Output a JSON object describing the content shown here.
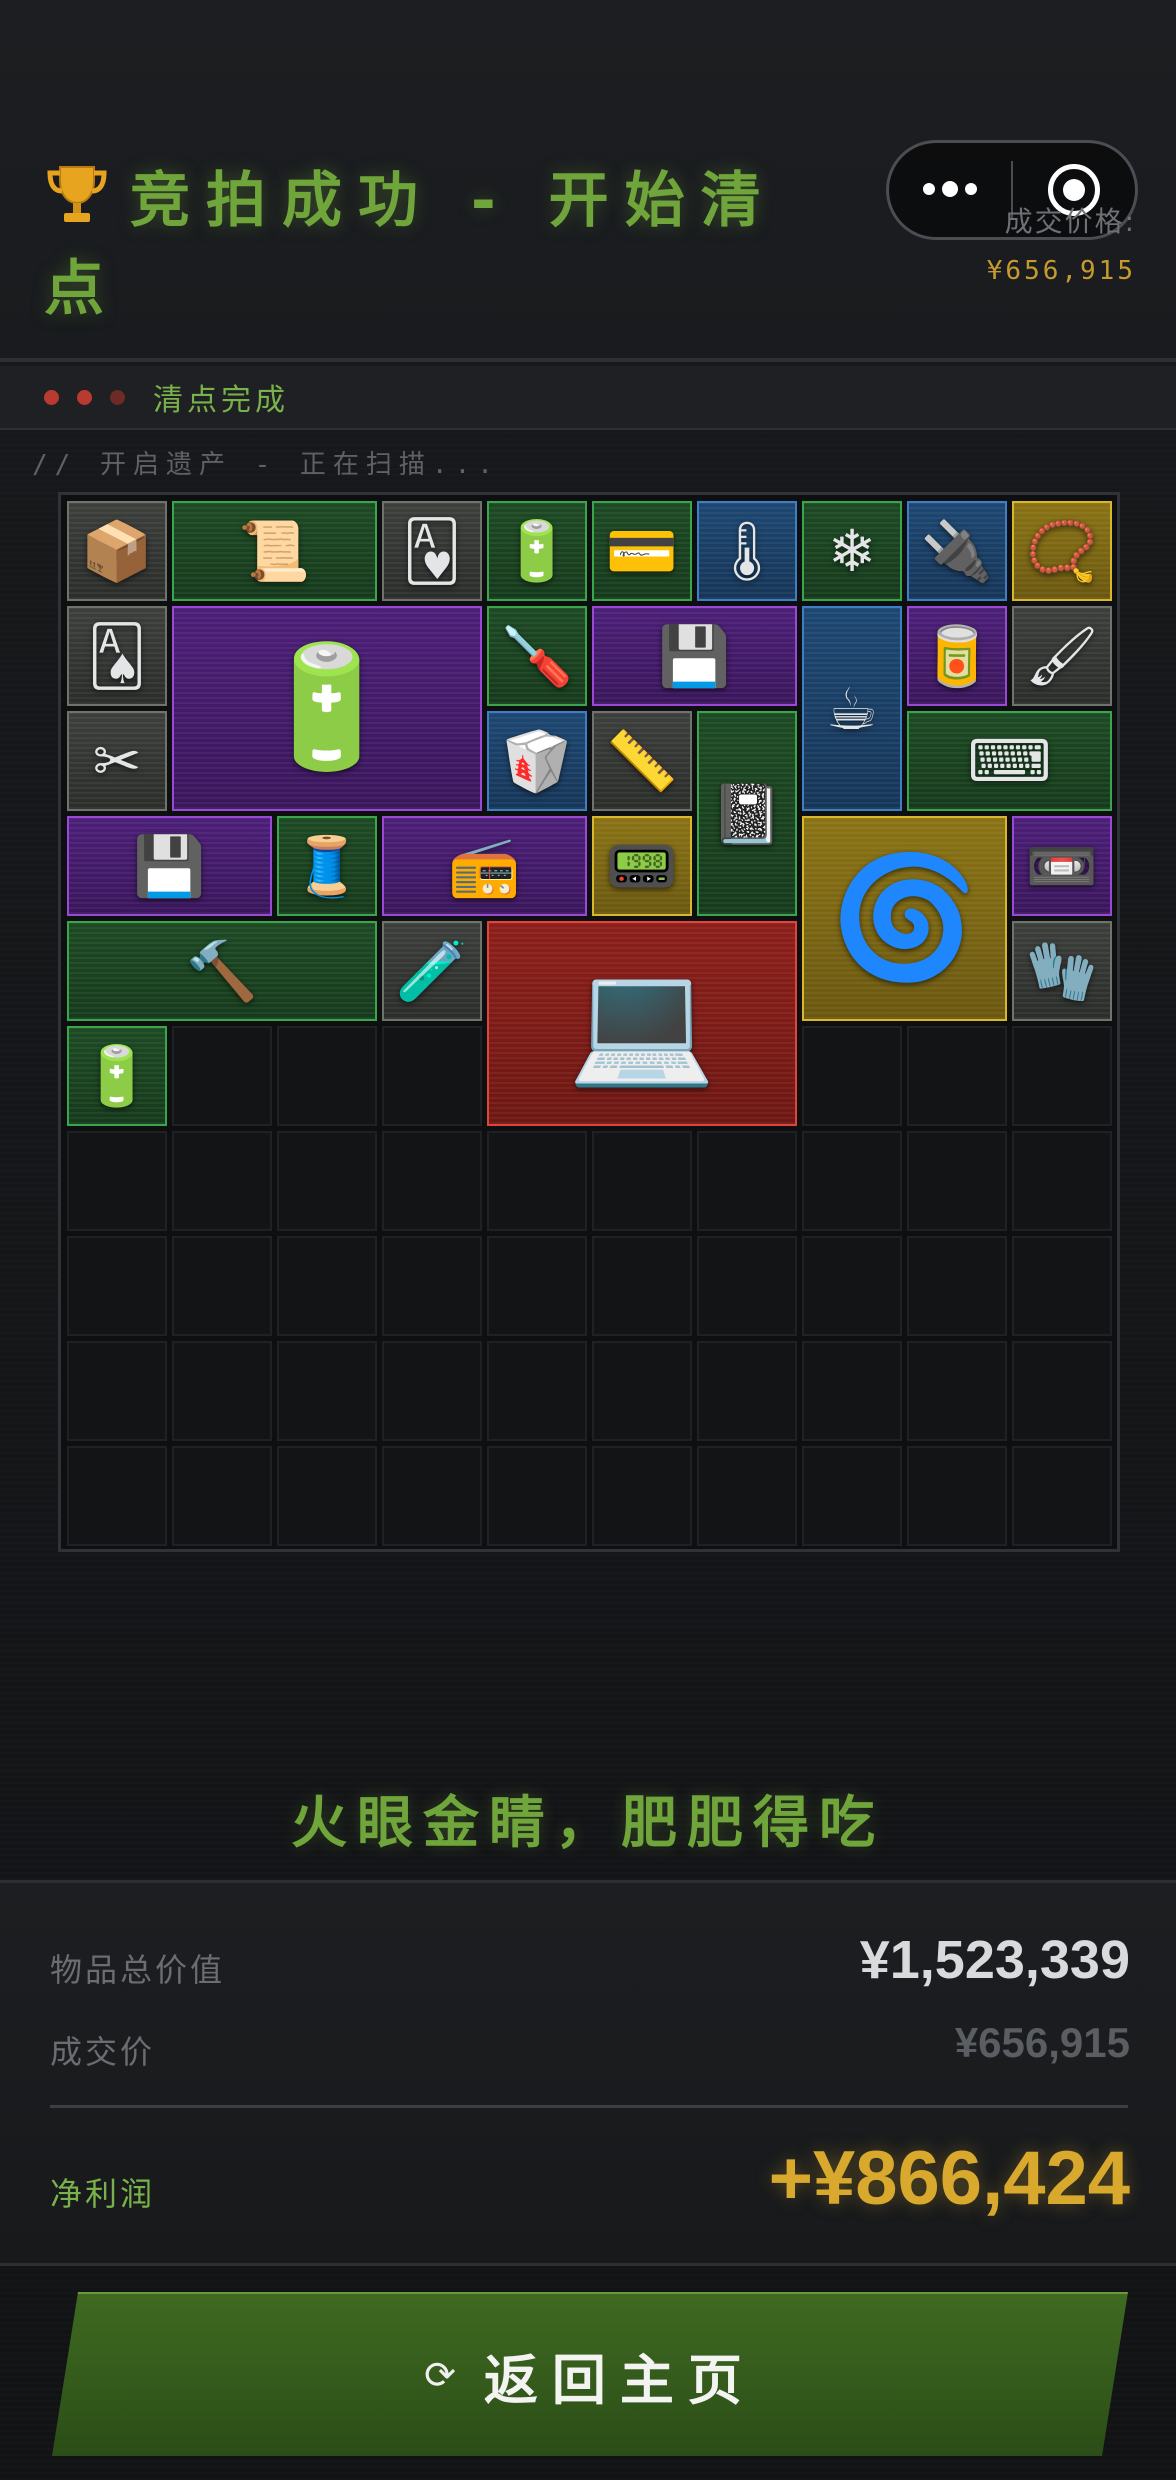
{
  "header": {
    "title": "竞拍成功 - 开始清点",
    "price_label": "成交价格:",
    "price_value": "¥656,915"
  },
  "status": {
    "dots": [
      "#b83a30",
      "#b83a30",
      "#6e2a26"
    ],
    "text": "清点完成"
  },
  "scan_text": "// 开启遗产 - 正在扫描...",
  "grid": {
    "cols": 10,
    "rows": 10,
    "items": [
      {
        "name": "cardboard-box-item",
        "icon": "📦",
        "rarity": "gray",
        "col": 0,
        "row": 0,
        "w": 1,
        "h": 1
      },
      {
        "name": "old-paper-item",
        "icon": "📜",
        "rarity": "green",
        "col": 1,
        "row": 0,
        "w": 2,
        "h": 1
      },
      {
        "name": "playing-card-portrait-item",
        "icon": "🂱",
        "rarity": "gray",
        "col": 3,
        "row": 0,
        "w": 1,
        "h": 1
      },
      {
        "name": "battery-pack-item",
        "icon": "🔋",
        "rarity": "green",
        "col": 4,
        "row": 0,
        "w": 1,
        "h": 1
      },
      {
        "name": "good-luck-card-item",
        "icon": "💳",
        "rarity": "green",
        "col": 5,
        "row": 0,
        "w": 1,
        "h": 1
      },
      {
        "name": "thermometer-gun-item",
        "icon": "🌡",
        "rarity": "blue",
        "col": 6,
        "row": 0,
        "w": 1,
        "h": 1
      },
      {
        "name": "cpu-cooler-item",
        "icon": "❄",
        "rarity": "green",
        "col": 7,
        "row": 0,
        "w": 1,
        "h": 1
      },
      {
        "name": "power-adapter-item",
        "icon": "🔌",
        "rarity": "blue",
        "col": 8,
        "row": 0,
        "w": 1,
        "h": 1
      },
      {
        "name": "gold-skull-necklace-item",
        "icon": "📿",
        "rarity": "gold",
        "col": 9,
        "row": 0,
        "w": 1,
        "h": 1
      },
      {
        "name": "playing-card-item",
        "icon": "🂡",
        "rarity": "gray",
        "col": 0,
        "row": 1,
        "w": 1,
        "h": 1
      },
      {
        "name": "car-battery-item",
        "icon": "🔋",
        "rarity": "purple",
        "col": 1,
        "row": 1,
        "w": 3,
        "h": 2
      },
      {
        "name": "screwdriver-tester-item",
        "icon": "🪛",
        "rarity": "green",
        "col": 4,
        "row": 1,
        "w": 1,
        "h": 1
      },
      {
        "name": "pci-card-item",
        "icon": "💾",
        "rarity": "purple",
        "col": 5,
        "row": 1,
        "w": 2,
        "h": 1
      },
      {
        "name": "coffee-pot-item",
        "icon": "☕",
        "rarity": "blue",
        "col": 7,
        "row": 1,
        "w": 1,
        "h": 2
      },
      {
        "name": "canned-food-item",
        "icon": "🥫",
        "rarity": "purple",
        "col": 8,
        "row": 1,
        "w": 1,
        "h": 1
      },
      {
        "name": "paint-brush-item",
        "icon": "🖌",
        "rarity": "gray",
        "col": 9,
        "row": 1,
        "w": 1,
        "h": 1
      },
      {
        "name": "scissors-clamp-item",
        "icon": "✂",
        "rarity": "gray",
        "col": 0,
        "row": 2,
        "w": 1,
        "h": 1
      },
      {
        "name": "ration-pack-item",
        "icon": "🥡",
        "rarity": "blue",
        "col": 4,
        "row": 2,
        "w": 1,
        "h": 1
      },
      {
        "name": "tape-measure-item",
        "icon": "📏",
        "rarity": "gray",
        "col": 5,
        "row": 2,
        "w": 1,
        "h": 1
      },
      {
        "name": "leather-journal-item",
        "icon": "📓",
        "rarity": "green",
        "col": 6,
        "row": 2,
        "w": 1,
        "h": 2
      },
      {
        "name": "keyboard-item",
        "icon": "⌨",
        "rarity": "green",
        "col": 8,
        "row": 2,
        "w": 2,
        "h": 1
      },
      {
        "name": "pci-card-2-item",
        "icon": "💾",
        "rarity": "purple",
        "col": 0,
        "row": 3,
        "w": 2,
        "h": 1
      },
      {
        "name": "green-cable-item",
        "icon": "🧵",
        "rarity": "green",
        "col": 2,
        "row": 3,
        "w": 1,
        "h": 1
      },
      {
        "name": "radio-item",
        "icon": "📻",
        "rarity": "purple",
        "col": 3,
        "row": 3,
        "w": 2,
        "h": 1
      },
      {
        "name": "circuit-module-item",
        "icon": "📟",
        "rarity": "gold",
        "col": 5,
        "row": 3,
        "w": 1,
        "h": 1
      },
      {
        "name": "cable-reel-item",
        "icon": "🌀",
        "rarity": "gold",
        "col": 7,
        "row": 3,
        "w": 2,
        "h": 2
      },
      {
        "name": "cassette-item",
        "icon": "📼",
        "rarity": "purple",
        "col": 9,
        "row": 3,
        "w": 1,
        "h": 1
      },
      {
        "name": "sledgehammer-item",
        "icon": "🔨",
        "rarity": "green",
        "col": 0,
        "row": 4,
        "w": 3,
        "h": 1
      },
      {
        "name": "glass-bottle-item",
        "icon": "🧪",
        "rarity": "gray",
        "col": 3,
        "row": 4,
        "w": 1,
        "h": 1
      },
      {
        "name": "rugged-laptop-case-item",
        "icon": "💻",
        "rarity": "red",
        "col": 4,
        "row": 4,
        "w": 3,
        "h": 2
      },
      {
        "name": "rubber-gloves-item",
        "icon": "🧤",
        "rarity": "gray",
        "col": 9,
        "row": 4,
        "w": 1,
        "h": 1
      },
      {
        "name": "nine-volt-battery-item",
        "icon": "🔋",
        "rarity": "green",
        "col": 0,
        "row": 5,
        "w": 1,
        "h": 1
      }
    ]
  },
  "slogan": "火眼金睛，肥肥得吃",
  "summary": {
    "total_label": "物品总价值",
    "total_value": "¥1,523,339",
    "deal_label": "成交价",
    "deal_value": "¥656,915",
    "profit_label": "净利润",
    "profit_value": "+¥866,424"
  },
  "colors": {
    "accent_green": "#6fa53a",
    "gold": "#d9a92e",
    "button_green": "#3f6a21"
  },
  "home_button": {
    "icon": "refresh-icon",
    "label": "返回主页"
  }
}
